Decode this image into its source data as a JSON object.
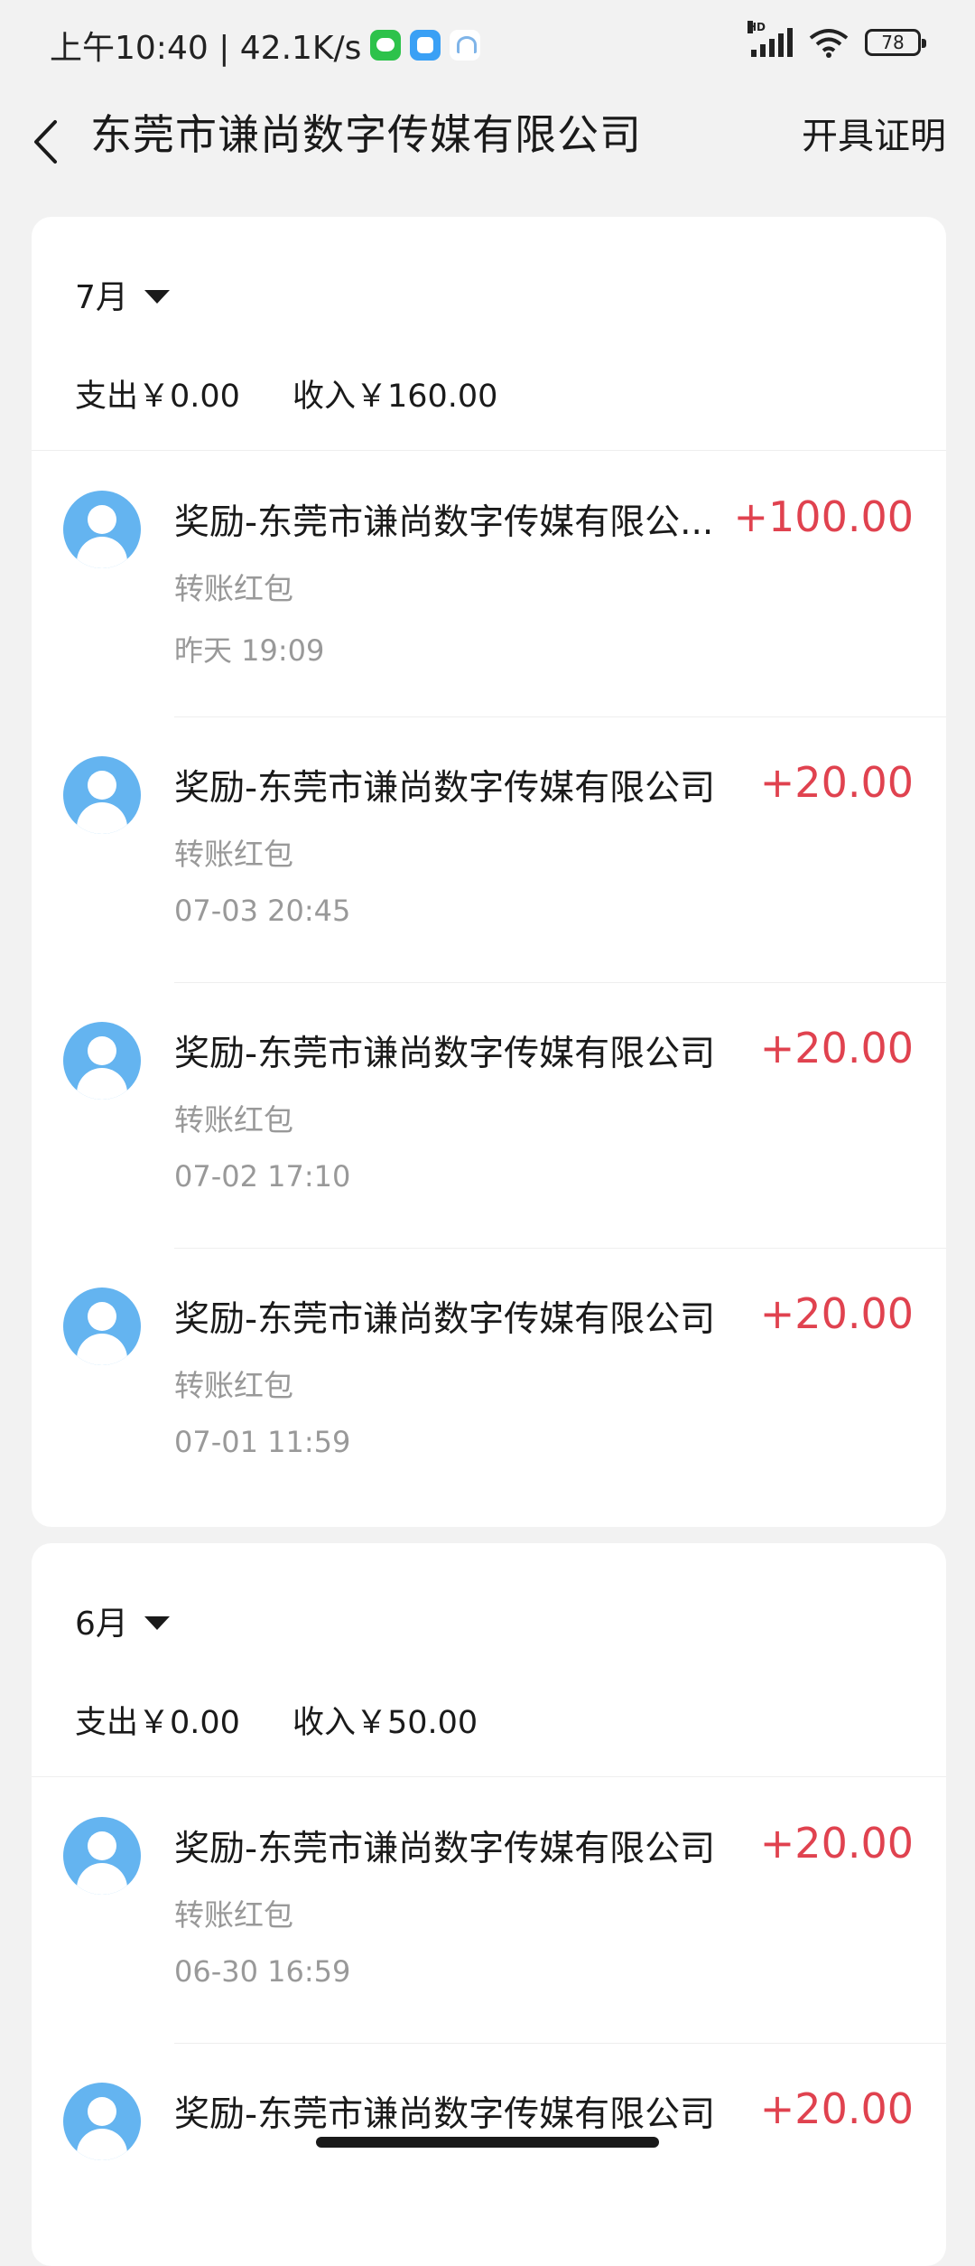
{
  "status_bar": {
    "time_speed": "上午10:40 | 42.1K/s",
    "notification_icons": [
      "wechat-icon",
      "app-square-icon",
      "cloud-app-icon"
    ],
    "signal_label": "HD",
    "battery": "78"
  },
  "header": {
    "title": "东莞市谦尚数字传媒有限公司",
    "action": "开具证明"
  },
  "months": [
    {
      "label": "7月",
      "expense": "支出￥0.00",
      "income": "收入￥160.00",
      "transactions": [
        {
          "title": "奖励-东莞市谦尚数字传媒有限公...",
          "type": "转账红包",
          "time": "昨天 19:09",
          "amount": "+100.00"
        },
        {
          "title": "奖励-东莞市谦尚数字传媒有限公司",
          "type": "转账红包",
          "time": "07-03 20:45",
          "amount": "+20.00"
        },
        {
          "title": "奖励-东莞市谦尚数字传媒有限公司",
          "type": "转账红包",
          "time": "07-02 17:10",
          "amount": "+20.00"
        },
        {
          "title": "奖励-东莞市谦尚数字传媒有限公司",
          "type": "转账红包",
          "time": "07-01 11:59",
          "amount": "+20.00"
        }
      ]
    },
    {
      "label": "6月",
      "expense": "支出￥0.00",
      "income": "收入￥50.00",
      "transactions": [
        {
          "title": "奖励-东莞市谦尚数字传媒有限公司",
          "type": "转账红包",
          "time": "06-30 16:59",
          "amount": "+20.00"
        },
        {
          "title": "奖励-东莞市谦尚数字传媒有限公司",
          "type": "",
          "time": "",
          "amount": "+20.00"
        }
      ]
    }
  ],
  "colors": {
    "background": "#f2f2f2",
    "card": "#ffffff",
    "income_amount": "#e0424f",
    "secondary_text": "#999999",
    "avatar": "#64b4f0"
  }
}
